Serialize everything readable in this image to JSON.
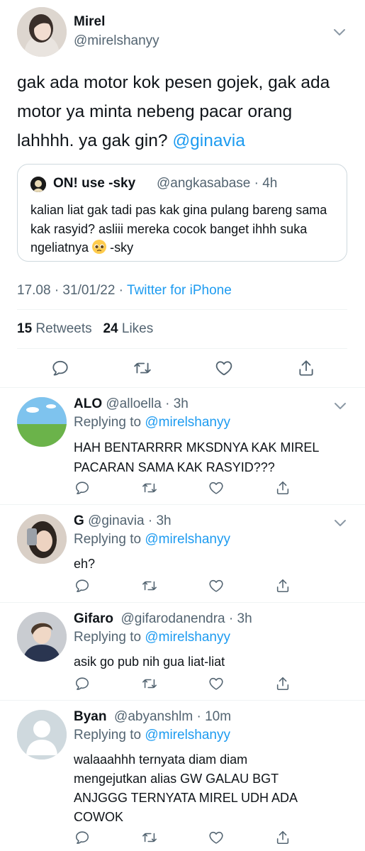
{
  "tweet": {
    "author_name": "Mirel",
    "author_handle": "@mirelshanyy",
    "text": "gak ada motor kok pesen gojek, gak ada motor ya minta nebeng pacar orang lahhhh. ya gak gin?",
    "mention": "@ginavia",
    "quote": {
      "name": "ON! use -sky",
      "meta": "@angkasabase · 4h",
      "text_before_emoji": "kalian liat gak tadi pas kak gina pulang bareng sama kak rasyid? asliii mereka cocok banget ihhh suka ngeliatnya",
      "text_after_emoji": "-sky"
    },
    "timestamp": "17.08 · 31/01/22 · ",
    "source": "Twitter for iPhone",
    "retweet_count": "15",
    "retweet_label": "Retweets",
    "like_count": "24",
    "like_label": "Likes"
  },
  "replies": [
    {
      "name": "ALO",
      "meta": "@alloella · 3h",
      "replying_label": "Replying to",
      "replying_to": "@mirelshanyy",
      "text": "HAH BENTARRRR MKSDNYA KAK MIREL PACARAN SAMA KAK RASYID???"
    },
    {
      "name": "G",
      "meta": "@ginavia · 3h",
      "replying_label": "Replying to",
      "replying_to": "@mirelshanyy",
      "text": "eh?"
    },
    {
      "name": "Gifaro",
      "meta": "@gifarodanendra · 3h",
      "replying_label": "Replying to",
      "replying_to": "@mirelshanyy",
      "text": "asik go pub nih gua liat-liat"
    },
    {
      "name": "Byan",
      "meta": "@abyanshlm · 10m",
      "replying_label": "Replying to",
      "replying_to": "@mirelshanyy",
      "text": "walaaahhh ternyata diam diam mengejutkan alias GW GALAU BGT ANJGGG TERNYATA MIREL UDH ADA COWOK"
    }
  ],
  "icons": [
    "chevron-down-icon",
    "reply-icon",
    "retweet-icon",
    "like-icon",
    "share-icon",
    "pleading-face-emoji",
    "default-avatar-icon"
  ],
  "colors": {
    "accent": "#1d9bf0",
    "text": "#0f1419",
    "secondary": "#536471",
    "border": "#cfd9de",
    "divider": "#eff3f4"
  }
}
